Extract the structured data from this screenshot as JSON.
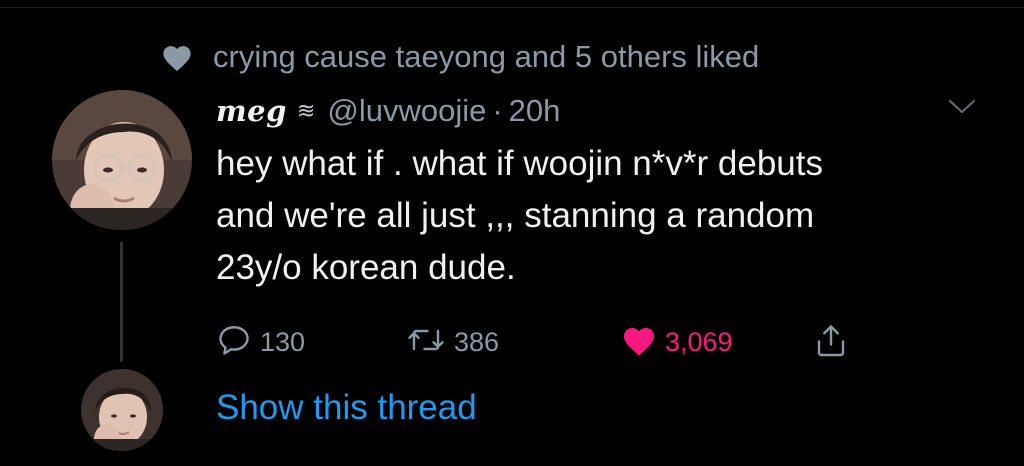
{
  "social_context": {
    "icon": "heart-icon",
    "text": "crying cause taeyong and 5 others liked"
  },
  "tweet": {
    "display_name": "meg",
    "name_emoji": "≋",
    "handle": "@luvwoojie",
    "separator": "·",
    "time": "20h",
    "text_lines": [
      "hey what if . what if woojin n*v*r debuts",
      "and we're all just ,,, stanning a random",
      "23y/o korean dude."
    ],
    "actions": {
      "reply_count": "130",
      "retweet_count": "386",
      "like_count": "3,069",
      "liked": true
    }
  },
  "thread": {
    "label": "Show this thread"
  },
  "colors": {
    "background": "#000000",
    "text": "#f1f1f1",
    "muted": "#8b98a5",
    "like": "#f91880",
    "link": "#1d9bf0"
  }
}
